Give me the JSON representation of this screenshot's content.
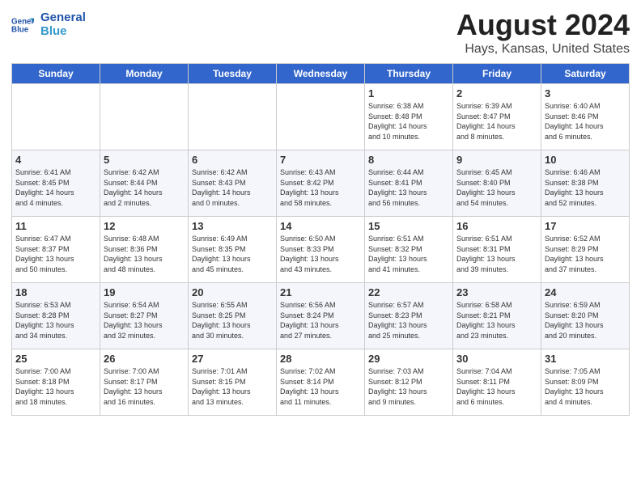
{
  "header": {
    "logo_line1": "General",
    "logo_line2": "Blue",
    "main_title": "August 2024",
    "subtitle": "Hays, Kansas, United States"
  },
  "weekdays": [
    "Sunday",
    "Monday",
    "Tuesday",
    "Wednesday",
    "Thursday",
    "Friday",
    "Saturday"
  ],
  "weeks": [
    [
      {
        "day": "",
        "info": ""
      },
      {
        "day": "",
        "info": ""
      },
      {
        "day": "",
        "info": ""
      },
      {
        "day": "",
        "info": ""
      },
      {
        "day": "1",
        "info": "Sunrise: 6:38 AM\nSunset: 8:48 PM\nDaylight: 14 hours\nand 10 minutes."
      },
      {
        "day": "2",
        "info": "Sunrise: 6:39 AM\nSunset: 8:47 PM\nDaylight: 14 hours\nand 8 minutes."
      },
      {
        "day": "3",
        "info": "Sunrise: 6:40 AM\nSunset: 8:46 PM\nDaylight: 14 hours\nand 6 minutes."
      }
    ],
    [
      {
        "day": "4",
        "info": "Sunrise: 6:41 AM\nSunset: 8:45 PM\nDaylight: 14 hours\nand 4 minutes."
      },
      {
        "day": "5",
        "info": "Sunrise: 6:42 AM\nSunset: 8:44 PM\nDaylight: 14 hours\nand 2 minutes."
      },
      {
        "day": "6",
        "info": "Sunrise: 6:42 AM\nSunset: 8:43 PM\nDaylight: 14 hours\nand 0 minutes."
      },
      {
        "day": "7",
        "info": "Sunrise: 6:43 AM\nSunset: 8:42 PM\nDaylight: 13 hours\nand 58 minutes."
      },
      {
        "day": "8",
        "info": "Sunrise: 6:44 AM\nSunset: 8:41 PM\nDaylight: 13 hours\nand 56 minutes."
      },
      {
        "day": "9",
        "info": "Sunrise: 6:45 AM\nSunset: 8:40 PM\nDaylight: 13 hours\nand 54 minutes."
      },
      {
        "day": "10",
        "info": "Sunrise: 6:46 AM\nSunset: 8:38 PM\nDaylight: 13 hours\nand 52 minutes."
      }
    ],
    [
      {
        "day": "11",
        "info": "Sunrise: 6:47 AM\nSunset: 8:37 PM\nDaylight: 13 hours\nand 50 minutes."
      },
      {
        "day": "12",
        "info": "Sunrise: 6:48 AM\nSunset: 8:36 PM\nDaylight: 13 hours\nand 48 minutes."
      },
      {
        "day": "13",
        "info": "Sunrise: 6:49 AM\nSunset: 8:35 PM\nDaylight: 13 hours\nand 45 minutes."
      },
      {
        "day": "14",
        "info": "Sunrise: 6:50 AM\nSunset: 8:33 PM\nDaylight: 13 hours\nand 43 minutes."
      },
      {
        "day": "15",
        "info": "Sunrise: 6:51 AM\nSunset: 8:32 PM\nDaylight: 13 hours\nand 41 minutes."
      },
      {
        "day": "16",
        "info": "Sunrise: 6:51 AM\nSunset: 8:31 PM\nDaylight: 13 hours\nand 39 minutes."
      },
      {
        "day": "17",
        "info": "Sunrise: 6:52 AM\nSunset: 8:29 PM\nDaylight: 13 hours\nand 37 minutes."
      }
    ],
    [
      {
        "day": "18",
        "info": "Sunrise: 6:53 AM\nSunset: 8:28 PM\nDaylight: 13 hours\nand 34 minutes."
      },
      {
        "day": "19",
        "info": "Sunrise: 6:54 AM\nSunset: 8:27 PM\nDaylight: 13 hours\nand 32 minutes."
      },
      {
        "day": "20",
        "info": "Sunrise: 6:55 AM\nSunset: 8:25 PM\nDaylight: 13 hours\nand 30 minutes."
      },
      {
        "day": "21",
        "info": "Sunrise: 6:56 AM\nSunset: 8:24 PM\nDaylight: 13 hours\nand 27 minutes."
      },
      {
        "day": "22",
        "info": "Sunrise: 6:57 AM\nSunset: 8:23 PM\nDaylight: 13 hours\nand 25 minutes."
      },
      {
        "day": "23",
        "info": "Sunrise: 6:58 AM\nSunset: 8:21 PM\nDaylight: 13 hours\nand 23 minutes."
      },
      {
        "day": "24",
        "info": "Sunrise: 6:59 AM\nSunset: 8:20 PM\nDaylight: 13 hours\nand 20 minutes."
      }
    ],
    [
      {
        "day": "25",
        "info": "Sunrise: 7:00 AM\nSunset: 8:18 PM\nDaylight: 13 hours\nand 18 minutes."
      },
      {
        "day": "26",
        "info": "Sunrise: 7:00 AM\nSunset: 8:17 PM\nDaylight: 13 hours\nand 16 minutes."
      },
      {
        "day": "27",
        "info": "Sunrise: 7:01 AM\nSunset: 8:15 PM\nDaylight: 13 hours\nand 13 minutes."
      },
      {
        "day": "28",
        "info": "Sunrise: 7:02 AM\nSunset: 8:14 PM\nDaylight: 13 hours\nand 11 minutes."
      },
      {
        "day": "29",
        "info": "Sunrise: 7:03 AM\nSunset: 8:12 PM\nDaylight: 13 hours\nand 9 minutes."
      },
      {
        "day": "30",
        "info": "Sunrise: 7:04 AM\nSunset: 8:11 PM\nDaylight: 13 hours\nand 6 minutes."
      },
      {
        "day": "31",
        "info": "Sunrise: 7:05 AM\nSunset: 8:09 PM\nDaylight: 13 hours\nand 4 minutes."
      }
    ]
  ]
}
